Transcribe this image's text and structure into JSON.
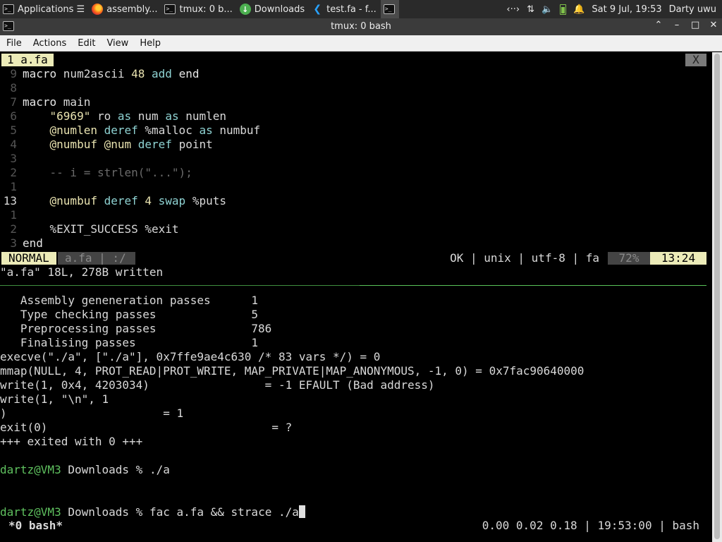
{
  "panel": {
    "tasks": [
      {
        "label": "Applications ☰",
        "icon": "applications-icon"
      },
      {
        "label": "assembly...",
        "icon": "firefox-icon"
      },
      {
        "label": "tmux: 0 b...",
        "icon": "terminal-icon"
      },
      {
        "label": "Downloads",
        "icon": "download-icon"
      },
      {
        "label": "test.fa - f...",
        "icon": "vscode-icon"
      }
    ],
    "tray": {
      "network": "‹··›",
      "transfer": "⇅",
      "volume": "🔈",
      "bell": "🔔",
      "datetime": "Sat  9 Jul, 19:53",
      "user": "Darty uwu"
    }
  },
  "window": {
    "title": "tmux: 0 bash",
    "controls": {
      "up": "⌃",
      "min": "–",
      "max": "□",
      "close": "✕"
    }
  },
  "menu": [
    "File",
    "Actions",
    "Edit",
    "View",
    "Help"
  ],
  "editor": {
    "tab_label": "1  a.fa",
    "tab_close": "X",
    "lines": [
      {
        "n": "9",
        "cur": false,
        "parts": [
          [
            "kw",
            "macro "
          ],
          [
            "fn",
            "num2ascii "
          ],
          [
            "str",
            "48 "
          ],
          [
            "ac",
            "add "
          ],
          [
            "kw",
            "end"
          ]
        ]
      },
      {
        "n": "8",
        "cur": false,
        "parts": []
      },
      {
        "n": "7",
        "cur": false,
        "parts": [
          [
            "kw",
            "macro "
          ],
          [
            "fn",
            "main"
          ]
        ]
      },
      {
        "n": "6",
        "cur": false,
        "parts": [
          [
            "fn",
            "    "
          ],
          [
            "str",
            "\"6969\" "
          ],
          [
            "fn",
            "ro "
          ],
          [
            "ac",
            "as "
          ],
          [
            "fn",
            "num "
          ],
          [
            "ac",
            "as "
          ],
          [
            "fn",
            "numlen"
          ]
        ]
      },
      {
        "n": "5",
        "cur": false,
        "parts": [
          [
            "fn",
            "    "
          ],
          [
            "str",
            "@numlen "
          ],
          [
            "ac",
            "deref "
          ],
          [
            "fn",
            "%malloc "
          ],
          [
            "ac",
            "as "
          ],
          [
            "fn",
            "numbuf"
          ]
        ]
      },
      {
        "n": "4",
        "cur": false,
        "parts": [
          [
            "fn",
            "    "
          ],
          [
            "str",
            "@numbuf @num "
          ],
          [
            "ac",
            "deref "
          ],
          [
            "fn",
            "point"
          ]
        ]
      },
      {
        "n": "3",
        "cur": false,
        "parts": []
      },
      {
        "n": "2",
        "cur": false,
        "parts": [
          [
            "fn",
            "    "
          ],
          [
            "cm",
            "-- i = strlen(\"...\");"
          ]
        ]
      },
      {
        "n": "1",
        "cur": false,
        "parts": []
      },
      {
        "n": "13",
        "cur": true,
        "parts": [
          [
            "fn",
            "    "
          ],
          [
            "str",
            "@numbuf "
          ],
          [
            "ac",
            "deref "
          ],
          [
            "str",
            "4 "
          ],
          [
            "ac",
            "swap "
          ],
          [
            "fn",
            "%puts"
          ]
        ]
      },
      {
        "n": "1",
        "cur": false,
        "parts": []
      },
      {
        "n": "2",
        "cur": false,
        "parts": [
          [
            "fn",
            "    %EXIT_SUCCESS %exit"
          ]
        ]
      },
      {
        "n": "3",
        "cur": false,
        "parts": [
          [
            "kw",
            "end"
          ]
        ]
      }
    ],
    "status": {
      "mode": "NORMAL",
      "file": "a.fa | :/",
      "info": "OK | unix | utf-8 | fa",
      "percent": "72%",
      "position": "13:24"
    },
    "message": "\"a.fa\" 18L, 278B written"
  },
  "shell": {
    "output": [
      "   Assembly geneneration passes      1",
      "   Type checking passes              5",
      "   Preprocessing passes              786",
      "   Finalising passes                 1",
      "execve(\"./a\", [\"./a\"], 0x7ffe9ae4c630 /* 83 vars */) = 0",
      "mmap(NULL, 4, PROT_READ|PROT_WRITE, MAP_PRIVATE|MAP_ANONYMOUS, -1, 0) = 0x7fac90640000",
      "write(1, 0x4, 4203034)                 = -1 EFAULT (Bad address)",
      "write(1, \"\\n\", 1",
      ")                       = 1",
      "exit(0)                                 = ?",
      "+++ exited with 0 +++"
    ],
    "prompt_user": "dartz@VM3",
    "prompt_dir": " Downloads % ",
    "cmd1": "./a",
    "cmd2": "fac a.fa && strace ./a"
  },
  "tmux": {
    "window": "*0 bash*",
    "status_right": "0.00 0.02 0.18 | 19:53:00 | bash"
  }
}
